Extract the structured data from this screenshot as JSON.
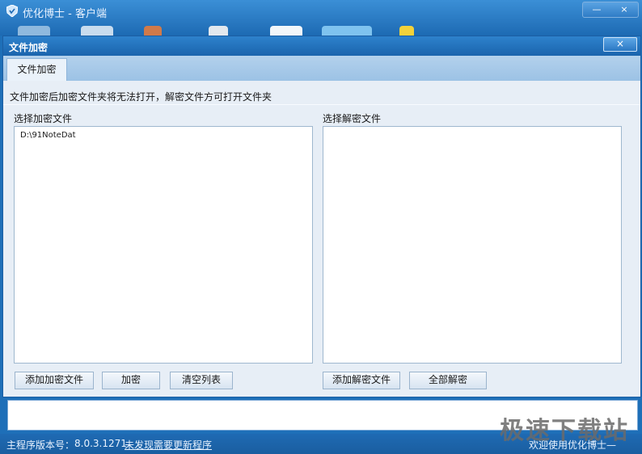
{
  "app": {
    "title": "优化博士 - 客户端",
    "window_controls": [
      "—",
      "×"
    ],
    "colors": {
      "chrome": "#1d6ab3",
      "accent": "#3b8fd6"
    }
  },
  "dialog": {
    "title": "文件加密",
    "close_label": "×",
    "tabs": [
      {
        "label": "文件加密",
        "active": true
      }
    ],
    "hint": "文件加密后加密文件夹将无法打开，解密文件方可打开文件夹",
    "encrypt_panel": {
      "label": "选择加密文件",
      "items": [
        "D:\\91NoteDat"
      ]
    },
    "decrypt_panel": {
      "label": "选择解密文件",
      "items": []
    },
    "buttons": {
      "add_encrypt": "添加加密文件",
      "encrypt": "加密",
      "clear_list": "清空列表",
      "add_decrypt": "添加解密文件",
      "decrypt_all": "全部解密"
    }
  },
  "statusbar": {
    "version_label": "主程序版本号：",
    "version": "8.0.3.1271",
    "update_link": "未发现需要更新程序",
    "welcome": "欢迎使用优化博士—"
  },
  "watermark": "极速下载站"
}
